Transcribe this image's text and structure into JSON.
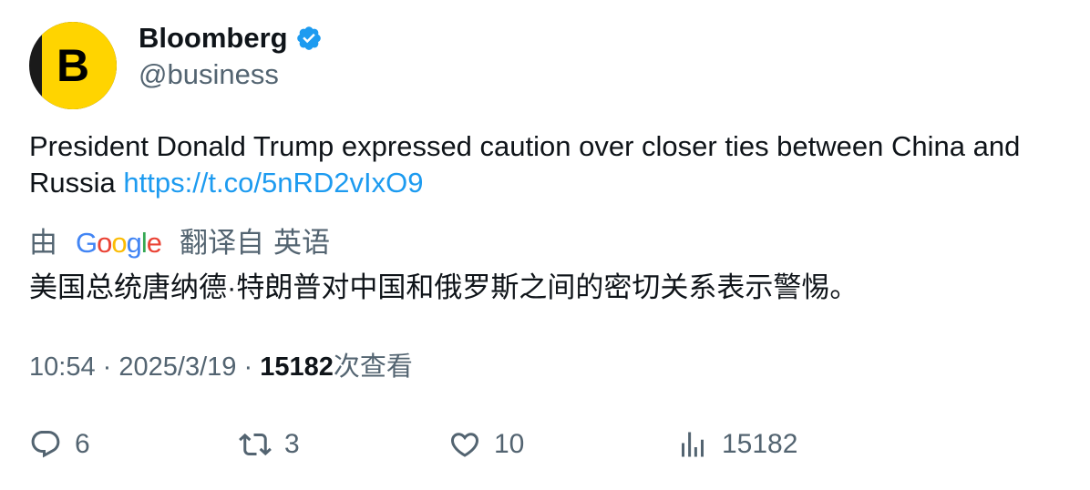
{
  "author": {
    "name": "Bloomberg",
    "handle": "@business",
    "avatar_letter": "B",
    "verified": true
  },
  "tweet": {
    "text": "President Donald Trump expressed caution over closer ties between China and Russia ",
    "link": "https://t.co/5nRD2vIxO9"
  },
  "translation": {
    "by_label": "由",
    "provider": "Google",
    "translated_from": "翻译自",
    "language": "英语",
    "text": "美国总统唐纳德·特朗普对中国和俄罗斯之间的密切关系表示警惕。"
  },
  "meta": {
    "time": "10:54",
    "date": "2025/3/19",
    "separator": "·",
    "views_count": "15182",
    "views_label": "次查看"
  },
  "actions": {
    "replies": "6",
    "retweets": "3",
    "likes": "10",
    "views": "15182"
  },
  "colors": {
    "link": "#1d9bf0",
    "secondary_text": "#536471",
    "verified": "#1d9bf0",
    "brand_yellow": "#ffd400"
  },
  "icons": [
    "verified-badge-icon",
    "reply-icon",
    "retweet-icon",
    "like-icon",
    "views-icon"
  ]
}
